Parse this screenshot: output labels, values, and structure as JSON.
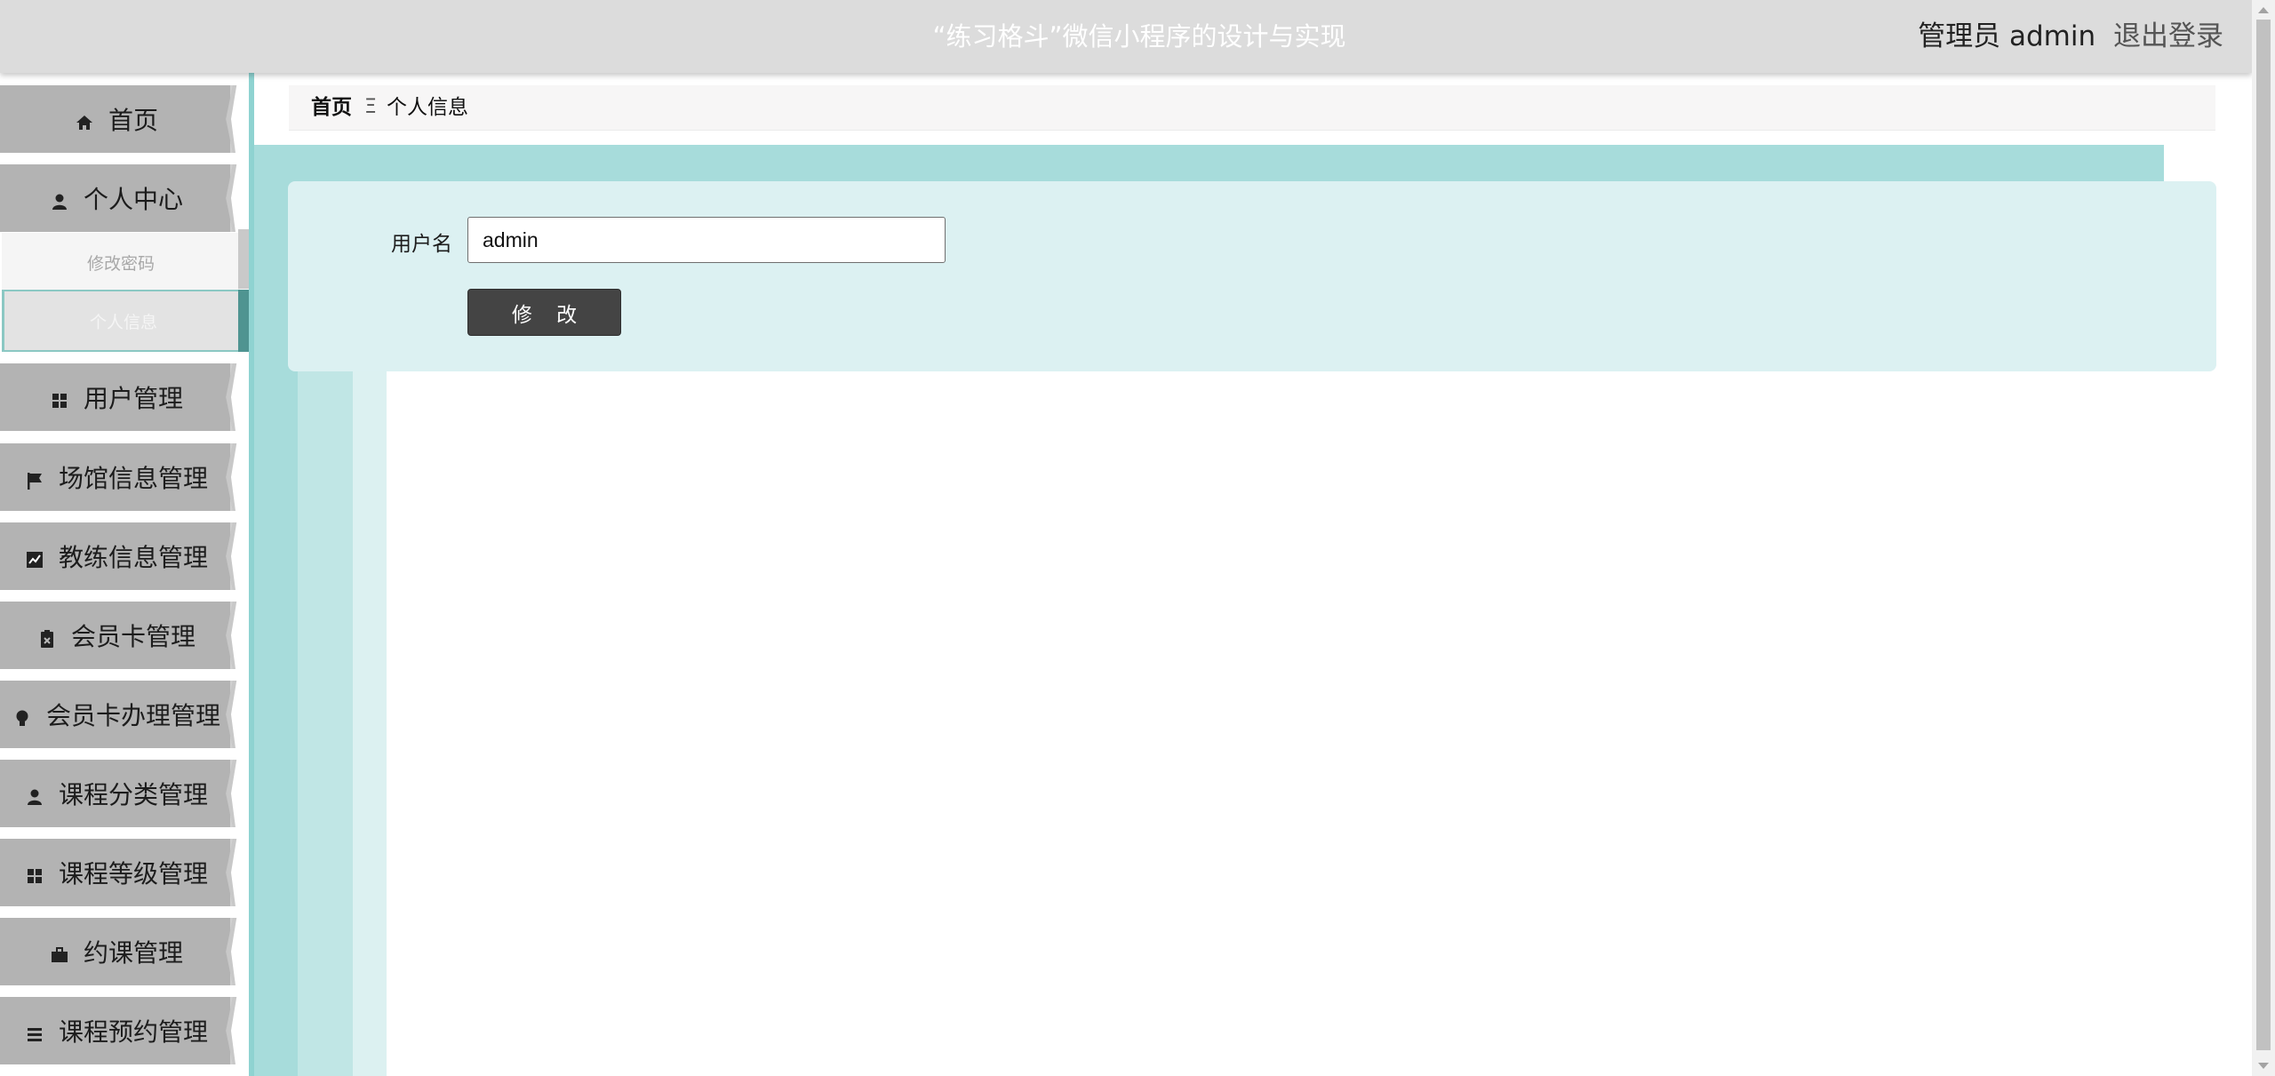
{
  "header": {
    "title": "“练习格斗”微信小程序的设计与实现",
    "user_label": "管理员 admin",
    "logout_label": "退出登录"
  },
  "sidebar": {
    "items": [
      {
        "label": "首页",
        "icon": "home-icon"
      },
      {
        "label": "个人中心",
        "icon": "user-icon"
      },
      {
        "label": "用户管理",
        "icon": "grid-icon"
      },
      {
        "label": "场馆信息管理",
        "icon": "flag-icon"
      },
      {
        "label": "教练信息管理",
        "icon": "chart-icon"
      },
      {
        "label": "会员卡管理",
        "icon": "clipboard-icon"
      },
      {
        "label": "会员卡办理管理",
        "icon": "bulb-icon"
      },
      {
        "label": "课程分类管理",
        "icon": "user-icon"
      },
      {
        "label": "课程等级管理",
        "icon": "grid-icon"
      },
      {
        "label": "约课管理",
        "icon": "briefcase-icon"
      },
      {
        "label": "课程预约管理",
        "icon": "list-icon"
      }
    ],
    "subitems": [
      {
        "label": "修改密码"
      },
      {
        "label": "个人信息"
      }
    ]
  },
  "breadcrumb": {
    "home": "首页",
    "separator": "Ξ",
    "current": "个人信息"
  },
  "form": {
    "username_label": "用户名",
    "username_value": "admin",
    "submit_label": "修 改"
  },
  "colors": {
    "header_bg": "#dcdcdc",
    "sidebar_item_bg": "#b3b3b3",
    "teal_bg": "#a7dcdb",
    "panel_bg": "#dcf1f2",
    "button_bg": "#444444"
  }
}
